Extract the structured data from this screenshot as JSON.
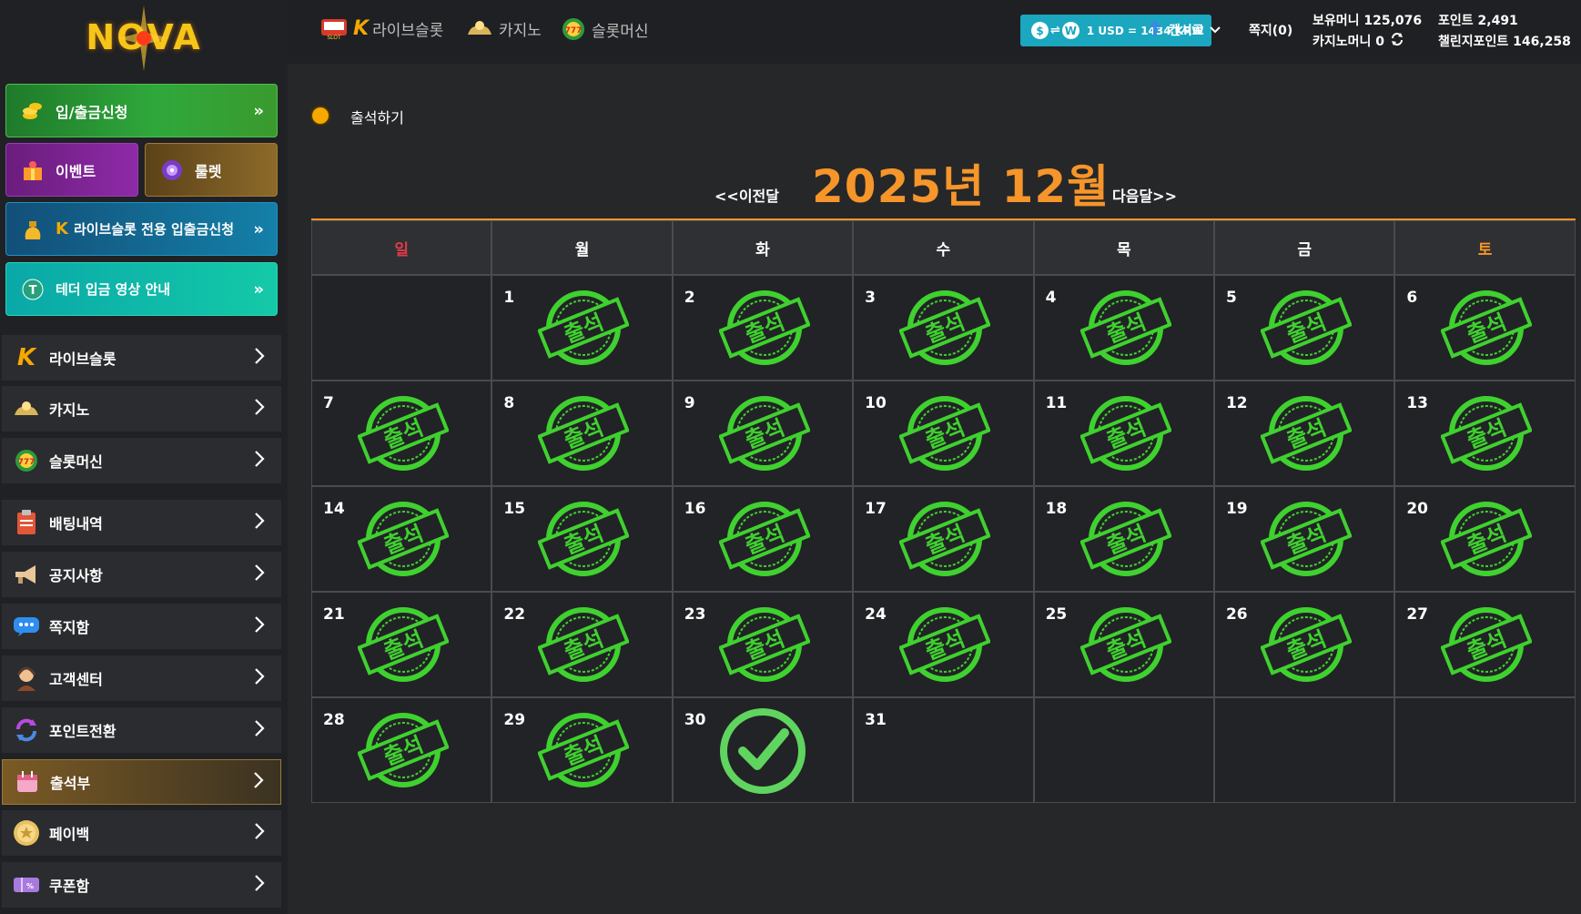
{
  "logo": {
    "text": "NOVA"
  },
  "sidebar": {
    "promo_buttons": [
      {
        "label": "입/출금신청",
        "icon": "coins-icon"
      },
      {
        "label": "이벤트",
        "icon": "gift-icon"
      },
      {
        "label": "룰렛",
        "icon": "roulette-icon"
      },
      {
        "label": "라이브슬롯 전용 입출금신청",
        "icon": "money-bag-icon"
      },
      {
        "label": "테더 입금 영상 안내",
        "icon": "tether-icon"
      }
    ],
    "nav": [
      {
        "label": "라이브슬롯",
        "icon": "k-logo-icon"
      },
      {
        "label": "카지노",
        "icon": "casino-icon"
      },
      {
        "label": "슬롯머신",
        "icon": "slot-777-icon"
      },
      {
        "label": "배팅내역",
        "icon": "clipboard-icon"
      },
      {
        "label": "공지사항",
        "icon": "megaphone-icon"
      },
      {
        "label": "쪽지함",
        "icon": "chat-icon"
      },
      {
        "label": "고객센터",
        "icon": "agent-icon"
      },
      {
        "label": "포인트전환",
        "icon": "refresh-icon"
      },
      {
        "label": "출석부",
        "icon": "calendar-icon",
        "active": true
      },
      {
        "label": "페이백",
        "icon": "coin-icon"
      },
      {
        "label": "쿠폰함",
        "icon": "coupon-icon"
      }
    ]
  },
  "topbar": {
    "nav": [
      {
        "label": "라이브슬롯",
        "icon": "slot-machine-icon"
      },
      {
        "label": "카지노",
        "icon": "casino-icon"
      },
      {
        "label": "슬롯머신",
        "icon": "slot-777-icon"
      }
    ],
    "rate": {
      "from": "$",
      "to": "W",
      "text": "1 USD = 1434 KRW"
    },
    "user": "켄시로",
    "messages": "쪽지(0)",
    "holding_money": "보유머니 125,076",
    "casino_money": "카지노머니 0",
    "points": "포인트 2,491",
    "challenge_points": "챌린지포인트 146,258"
  },
  "main": {
    "section_title": "출석하기",
    "month_title": "2025년 12월",
    "prev_label": "<<이전달",
    "next_label": "다음달>>",
    "weekdays": [
      "일",
      "월",
      "화",
      "수",
      "목",
      "금",
      "토"
    ],
    "weekday_colors": {
      "sun": "#e03a4a",
      "sat": "#f5952a",
      "default": "#ffffff"
    },
    "stamp_text": "출석",
    "stamp_color": "#3fd12f",
    "first_weekday_offset": 1,
    "days_in_month": 31,
    "attended_days": [
      1,
      2,
      3,
      4,
      5,
      6,
      7,
      8,
      9,
      10,
      11,
      12,
      13,
      14,
      15,
      16,
      17,
      18,
      19,
      20,
      21,
      22,
      23,
      24,
      25,
      26,
      27,
      28,
      29
    ],
    "checked_days": [
      30
    ]
  }
}
